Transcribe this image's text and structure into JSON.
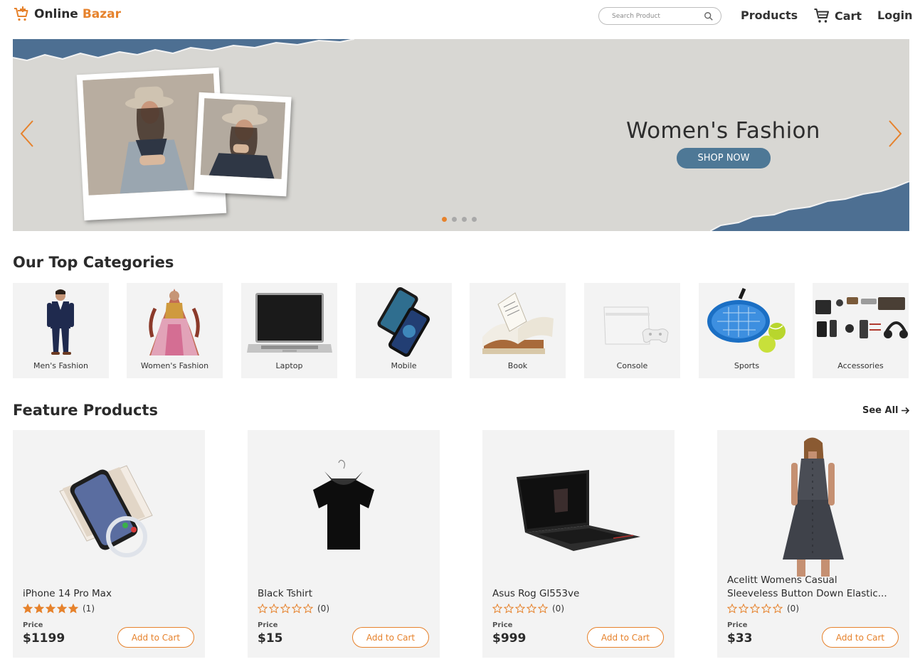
{
  "header": {
    "logo_part1": "Online",
    "logo_part2": "Bazar",
    "search_placeholder": "Search Product",
    "nav_products": "Products",
    "nav_cart": "Cart",
    "nav_login": "Login"
  },
  "banner": {
    "title": "Women's Fashion",
    "cta": "SHOP NOW",
    "slide_count": 4,
    "active_slide": 1
  },
  "categories": {
    "title": "Our Top Categories",
    "items": [
      {
        "label": "Men's Fashion"
      },
      {
        "label": "Women's Fashion"
      },
      {
        "label": "Laptop"
      },
      {
        "label": "Mobile"
      },
      {
        "label": "Book"
      },
      {
        "label": "Console"
      },
      {
        "label": "Sports"
      },
      {
        "label": "Accessories"
      }
    ]
  },
  "featured": {
    "title": "Feature Products",
    "see_all": "See All",
    "products": [
      {
        "name": "iPhone 14 Pro Max",
        "rating": 5,
        "reviews": "(1)",
        "price_label": "Price",
        "price": "$1199",
        "add_label": "Add to Cart"
      },
      {
        "name": "Black Tshirt",
        "rating": 0,
        "reviews": "(0)",
        "price_label": "Price",
        "price": "$15",
        "add_label": "Add to Cart"
      },
      {
        "name": "Asus Rog Gl553ve",
        "rating": 0,
        "reviews": "(0)",
        "price_label": "Price",
        "price": "$999",
        "add_label": "Add to Cart"
      },
      {
        "name_line1": "Acelitt Womens Casual",
        "name_line2": "Sleeveless Button Down Elastic...",
        "rating": 0,
        "reviews": "(0)",
        "price_label": "Price",
        "price": "$33",
        "add_label": "Add to Cart"
      }
    ]
  },
  "colors": {
    "accent": "#e6822c",
    "banner_bg": "#d8d7d3",
    "cta_bg": "#4e7896",
    "card_bg": "#f3f3f3"
  },
  "icons": [
    "cart-plus-icon",
    "search-icon",
    "cart-icon",
    "chevron-left-icon",
    "chevron-right-icon",
    "star-icon",
    "arrow-right-icon"
  ]
}
